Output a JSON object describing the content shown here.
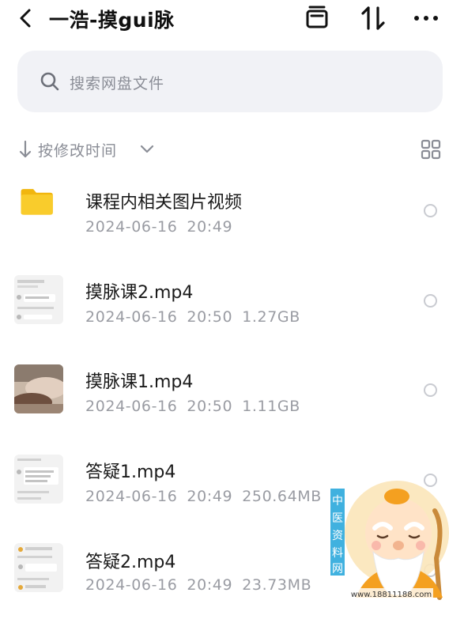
{
  "header": {
    "title": "一浩-摸gui脉",
    "icons": [
      "back-icon",
      "box-icon",
      "sort-swap-icon",
      "more-icon"
    ]
  },
  "search": {
    "placeholder": "搜索网盘文件"
  },
  "sort": {
    "label": "按修改时间"
  },
  "files": [
    {
      "name": "课程内相关图片视频",
      "date": "2024-06-16",
      "time": "20:49",
      "size": "",
      "type": "folder"
    },
    {
      "name": "摸脉课2.mp4",
      "date": "2024-06-16",
      "time": "20:50",
      "size": "1.27GB",
      "type": "video"
    },
    {
      "name": "摸脉课1.mp4",
      "date": "2024-06-16",
      "time": "20:50",
      "size": "1.11GB",
      "type": "video"
    },
    {
      "name": "答疑1.mp4",
      "date": "2024-06-16",
      "time": "20:49",
      "size": "250.64MB",
      "type": "video"
    },
    {
      "name": "答疑2.mp4",
      "date": "2024-06-16",
      "time": "20:49",
      "size": "23.73MB",
      "type": "video"
    }
  ],
  "watermark": {
    "vertical_text": [
      "中",
      "医",
      "资",
      "料",
      "网"
    ],
    "url": "www.18811188.com"
  },
  "colors": {
    "folder": "#f7c21f",
    "search_bg": "#f1f2f6",
    "muted_text": "#9a9ca3"
  }
}
